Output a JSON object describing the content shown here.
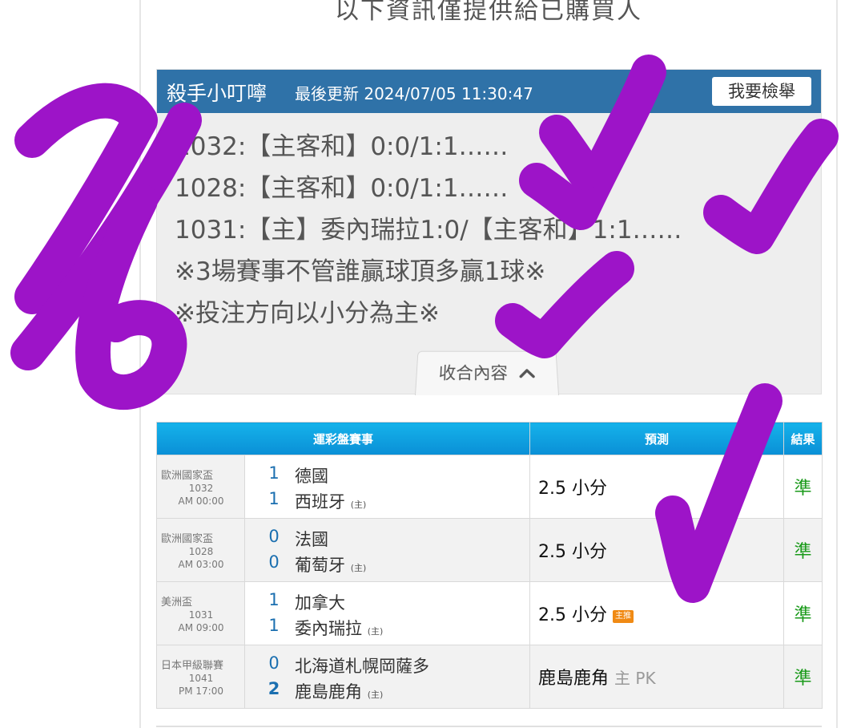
{
  "notice": "以下資訊僅提供給已購買人",
  "article": {
    "author": "殺手小叮嚀",
    "updated": "最後更新 2024/07/05 11:30:47",
    "report_label": "我要檢舉",
    "lines": [
      "1032:【主客和】0:0/1:1……",
      "1028:【主客和】0:0/1:1……",
      "1031:【主】委內瑞拉1:0/【主客和】1:1……",
      "※3場賽事不管誰贏球頂多贏1球※",
      "※投注方向以小分為主※"
    ],
    "collapse_label": "收合內容",
    "collapse_icon": "chevron-up-icon"
  },
  "table": {
    "headers": [
      "運彩盤賽事",
      "預測",
      "結果"
    ],
    "home_mark": "(主)",
    "rows": [
      {
        "league": "歐洲國家盃",
        "game_no": "1032",
        "time": "AM 00:00",
        "away": "德國",
        "away_score": "1",
        "home": "西班牙",
        "home_score": "1",
        "prediction": "2.5 小分",
        "extra": "",
        "tag": "",
        "result": "準"
      },
      {
        "league": "歐洲國家盃",
        "game_no": "1028",
        "time": "AM 03:00",
        "away": "法國",
        "away_score": "0",
        "home": "葡萄牙",
        "home_score": "0",
        "prediction": "2.5 小分",
        "extra": "",
        "tag": "",
        "result": "準"
      },
      {
        "league": "美洲盃",
        "game_no": "1031",
        "time": "AM 09:00",
        "away": "加拿大",
        "away_score": "1",
        "home": "委內瑞拉",
        "home_score": "1",
        "prediction": "2.5 小分",
        "extra": "",
        "tag": "主推",
        "result": "準"
      },
      {
        "league": "日本甲級聯賽",
        "game_no": "1041",
        "time": "PM 17:00",
        "away": "北海道札幌岡薩多",
        "away_score": "0",
        "home": "鹿島鹿角",
        "home_score": "2",
        "prediction": "鹿島鹿角",
        "extra": "主 PK",
        "tag": "",
        "result": "準"
      }
    ]
  },
  "colors": {
    "header_blue": "#2f72a8",
    "table_header": "#0a8fd6",
    "score_blue": "#1b6fb0",
    "result_green": "#1a9a1a",
    "ink_purple": "#9d14c8"
  },
  "annotation": {
    "handwritten": "4/6"
  }
}
